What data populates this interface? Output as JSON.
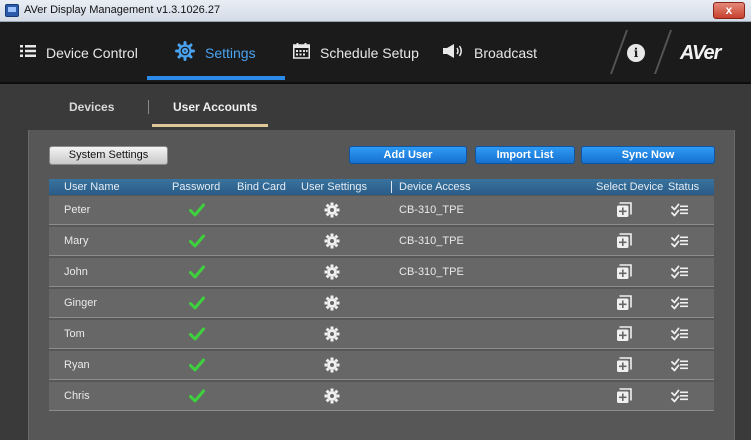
{
  "window": {
    "title": "AVer Display Management v1.3.1026.27",
    "close_label": "x"
  },
  "nav": {
    "items": [
      {
        "label": "Device Control",
        "icon": "list-icon"
      },
      {
        "label": "Settings",
        "icon": "gear-icon"
      },
      {
        "label": "Schedule Setup",
        "icon": "calendar-icon"
      },
      {
        "label": "Broadcast",
        "icon": "megaphone-icon"
      }
    ],
    "active": "Settings",
    "info_label": "i",
    "logo": "AVer"
  },
  "subtabs": [
    {
      "label": "Devices"
    },
    {
      "label": "User Accounts"
    }
  ],
  "active_subtab": "User Accounts",
  "toolbar": {
    "system_settings_label": "System Settings",
    "add_user_label": "Add User",
    "import_list_label": "Import List",
    "sync_now_label": "Sync Now"
  },
  "table": {
    "columns": [
      "User Name",
      "Password",
      "Bind Card",
      "User Settings",
      "Device Access",
      "Select Device",
      "Status"
    ],
    "rows": [
      {
        "name": "Peter",
        "password_set": true,
        "device_access": "CB-310_TPE"
      },
      {
        "name": "Mary",
        "password_set": true,
        "device_access": "CB-310_TPE"
      },
      {
        "name": "John",
        "password_set": true,
        "device_access": "CB-310_TPE"
      },
      {
        "name": "Ginger",
        "password_set": true,
        "device_access": ""
      },
      {
        "name": "Tom",
        "password_set": true,
        "device_access": ""
      },
      {
        "name": "Ryan",
        "password_set": true,
        "device_access": ""
      },
      {
        "name": "Chris",
        "password_set": true,
        "device_access": ""
      }
    ]
  },
  "colors": {
    "accent": "#2c8ae8",
    "check": "#3dd13d",
    "subtab_underline": "#e0c896",
    "table_header": "#2f648f"
  }
}
